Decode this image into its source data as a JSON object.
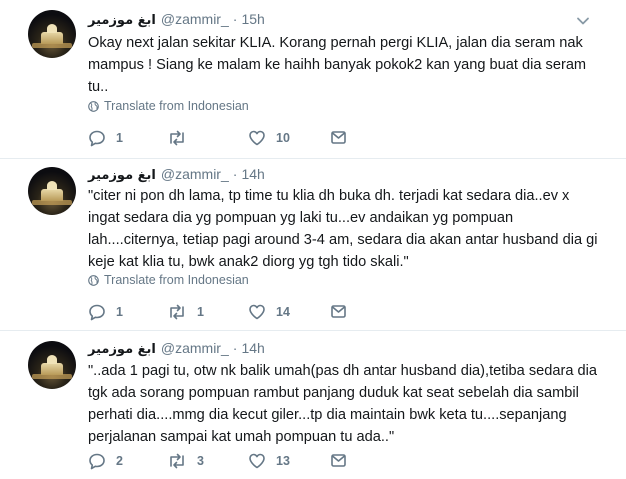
{
  "tweets": [
    {
      "name": "ابغ موزمير",
      "handle": "@zammir_",
      "separator": "·",
      "time": "15h",
      "text": "Okay next jalan sekitar KLIA. Korang pernah pergi KLIA, jalan dia seram nak mampus ! Siang ke malam ke haihh banyak pokok2 kan yang buat dia seram tu..",
      "translate": "Translate from Indonesian",
      "replies": "1",
      "retweets": "",
      "likes": "10"
    },
    {
      "name": "ابغ موزمير",
      "handle": "@zammir_",
      "separator": "·",
      "time": "14h",
      "text": "\"citer ni pon dh lama, tp time tu klia dh buka dh. terjadi kat sedara dia..ev x ingat sedara dia yg pompuan yg laki tu...ev andaikan yg pompuan lah....citernya, tetiap pagi around 3-4 am, sedara dia akan antar husband dia gi keje kat klia tu, bwk anak2 diorg yg tgh tido skali.\"",
      "translate": "Translate from Indonesian",
      "replies": "1",
      "retweets": "1",
      "likes": "14"
    },
    {
      "name": "ابغ موزمير",
      "handle": "@zammir_",
      "separator": "·",
      "time": "14h",
      "text": "\"..ada 1 pagi tu, otw nk balik umah(pas dh antar husband dia),tetiba sedara dia tgk ada sorang pompuan rambut panjang duduk kat seat sebelah dia sambil perhati dia....mmg dia kecut giler...tp dia maintain bwk keta tu....sepanjang perjalanan sampai kat umah pompuan tu ada..\"",
      "translate": "",
      "replies": "2",
      "retweets": "3",
      "likes": "13"
    }
  ],
  "icons": {
    "reply": "reply-icon",
    "retweet": "retweet-icon",
    "like": "heart-icon",
    "dm": "envelope-icon",
    "globe": "globe-icon",
    "caret": "chevron-down-icon"
  },
  "colors": {
    "text": "#14171a",
    "secondary": "#657786",
    "divider": "#e6ecf0"
  }
}
